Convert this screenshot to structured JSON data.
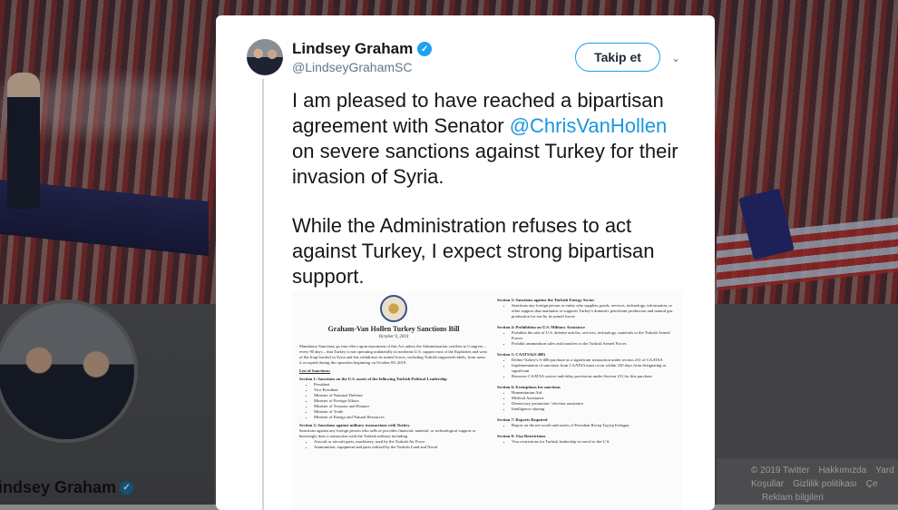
{
  "profile": {
    "name": "indsey Graham"
  },
  "footer": {
    "links": [
      "© 2019 Twitter",
      "Hakkımızda",
      "Yard",
      "Koşullar",
      "Gizlilik politikası",
      "Çe",
      "Reklam bilgileri"
    ]
  },
  "tweet": {
    "display_name": "Lindsey Graham",
    "handle": "@LindseyGrahamSC",
    "follow_label": "Takip et",
    "verified_glyph": "✓",
    "caret_glyph": "⌄",
    "text_line1_a": "I am pleased to have reached a bipartisan agreement with Senator ",
    "mention": "@ChrisVanHollen",
    "text_line1_b": " on severe sanctions against Turkey for their invasion of Syria.",
    "text_para2": "While the Administration refuses to act against Turkey, I expect strong bipartisan support."
  },
  "document": {
    "title": "Graham-Van Hollen Turkey Sanctions Bill",
    "date": "October 9, 2019",
    "intro": "Mandatory Sanctions go into effect upon enactment of this Act unless the Administration certifies to Congress – every 90 days – that Turkey is not operating unilaterally in northeast U.S. support east of the Euphrates and west of the Iraqi border) in Syria and has withdrawn its armed forces, including Turkish supported rebels, from areas it occupied during the operation beginning on October 09, 2019.",
    "list_heading": "List of Sanctions:",
    "sec1_title": "Section 1: Sanctions on the U.S. assets of the following Turkish Political Leadership",
    "sec1_items": [
      "President",
      "Vice President",
      "Minister of National Defense",
      "Minister of Foreign Affairs",
      "Minister of Treasury and Finance",
      "Minister of Trade",
      "Minister of Energy and Natural Resources"
    ],
    "sec2_title": "Section 2: Sanctions against military transactions with Turkey",
    "sec2_text": "Sanctions against any foreign person who sells or provides financial, material, or technological support or knowingly does a transaction with the Turkish military including",
    "sec2_items": [
      "Aircraft or aircraft parts, machinery, used by the Turkish Air Force",
      "Ammunition, equipment and parts utilized by the Turkish Land and Naval"
    ],
    "sec3_title": "Section 3: Sanctions against the Turkish Energy Sector",
    "sec3_items": [
      "Sanctions any foreign person or entity who supplies goods, services, technology, information, or other support that maintains or supports Turkey's domestic petroleum production and natural gas production for use by its armed forces"
    ],
    "sec4_title": "Section 4: Prohibition on U.S. Military Assistance",
    "sec4_items": [
      "Prohibits the sale of U.S. defense articles, services, technology, materials to the Turkish Armed Forces",
      "Prohibit ammunition sales and transfers to the Turkish Armed Forces"
    ],
    "sec5_title": "Section 5: CAATSA(S-400)",
    "sec5_items": [
      "Define Turkey's S-400 purchase as a significant transaction under section 231 of CAATSA",
      "Implementation of sanctions from CAATSA must occur within 100 days from designating as significant",
      "Removes CAATSA waiver and delay provisions under Section 231 for this purchase"
    ],
    "sec6_title": "Section 6: Exemptions for sanctions",
    "sec6_items": [
      "Humanitarian Aid",
      "Medical Assistance",
      "Democracy promotion / election assistance",
      "Intelligence sharing"
    ],
    "sec7_title": "Section 7: Reports Required",
    "sec7_items": [
      "Report on the net worth and assets of President Recep Tayyip Erdogan"
    ],
    "sec8_title": "Section 8: Visa Restrictions",
    "sec8_items": [
      "Visa restrictions for Turkish leadership to travel to the U.S."
    ]
  }
}
